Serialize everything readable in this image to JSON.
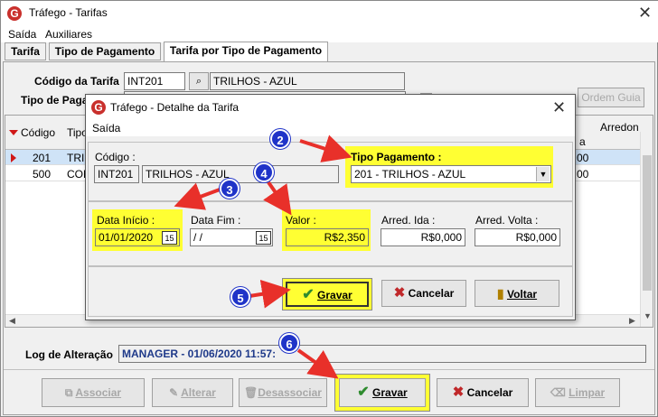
{
  "window": {
    "title": "Tráfego - Tarifas",
    "logo_letter": "G",
    "close": "✕"
  },
  "menu": [
    "Saída",
    "Auxiliares"
  ],
  "tabs": [
    "Tarifa",
    "Tipo de Pagamento",
    "Tarifa por Tipo de Pagamento"
  ],
  "form": {
    "codigo_label": "Código da Tarifa",
    "codigo_value": "INT201",
    "descricao_value": "TRILHOS - AZUL",
    "tipo_label": "Tipo de Paga",
    "ordem_button": "Ordem Guia"
  },
  "grid": {
    "headers": [
      "Código",
      "Tipo",
      "Arredon"
    ],
    "rows": [
      {
        "codigo": "201",
        "tipo": "TRIL",
        "tail": "00"
      },
      {
        "codigo": "500",
        "tipo": "COM",
        "tail": "00"
      }
    ],
    "partial_header": "a"
  },
  "log": {
    "label": "Log de Alteração",
    "value": "MANAGER - 01/06/2020 11:57:"
  },
  "bottom_buttons": {
    "associar": "Associar",
    "alterar": "Alterar",
    "desassociar": "Desassociar",
    "gravar": "Gravar",
    "cancelar": "Cancelar",
    "limpar": "Limpar"
  },
  "dialog": {
    "title": "Tráfego - Detalhe da Tarifa",
    "menu": "Saída",
    "codigo_label": "Código :",
    "codigo_value": "INT201",
    "descricao_value": "TRILHOS - AZUL",
    "tipo_pagamento_label": "Tipo Pagamento :",
    "tipo_pagamento_value": "201 - TRILHOS - AZUL",
    "data_inicio_label": "Data Início :",
    "data_inicio_value": "01/01/2020",
    "data_fim_label": "Data Fim :",
    "data_fim_value": " /  /",
    "valor_label": "Valor :",
    "valor_value": "R$2,350",
    "arred_ida_label": "Arred. Ida :",
    "arred_ida_value": "R$0,000",
    "arred_volta_label": "Arred. Volta :",
    "arred_volta_value": "R$0,000",
    "gravar": "Gravar",
    "cancelar": "Cancelar",
    "voltar": "Voltar",
    "calendar_glyph": "15"
  },
  "badges": [
    "2",
    "3",
    "4",
    "5",
    "6"
  ],
  "colors": {
    "highlight": "#ffff33",
    "badge": "#1f33c8",
    "arrow": "#e8302a",
    "log_text": "#1f3a8a",
    "check": "#2e8b2e",
    "cancel": "#c0282a"
  }
}
